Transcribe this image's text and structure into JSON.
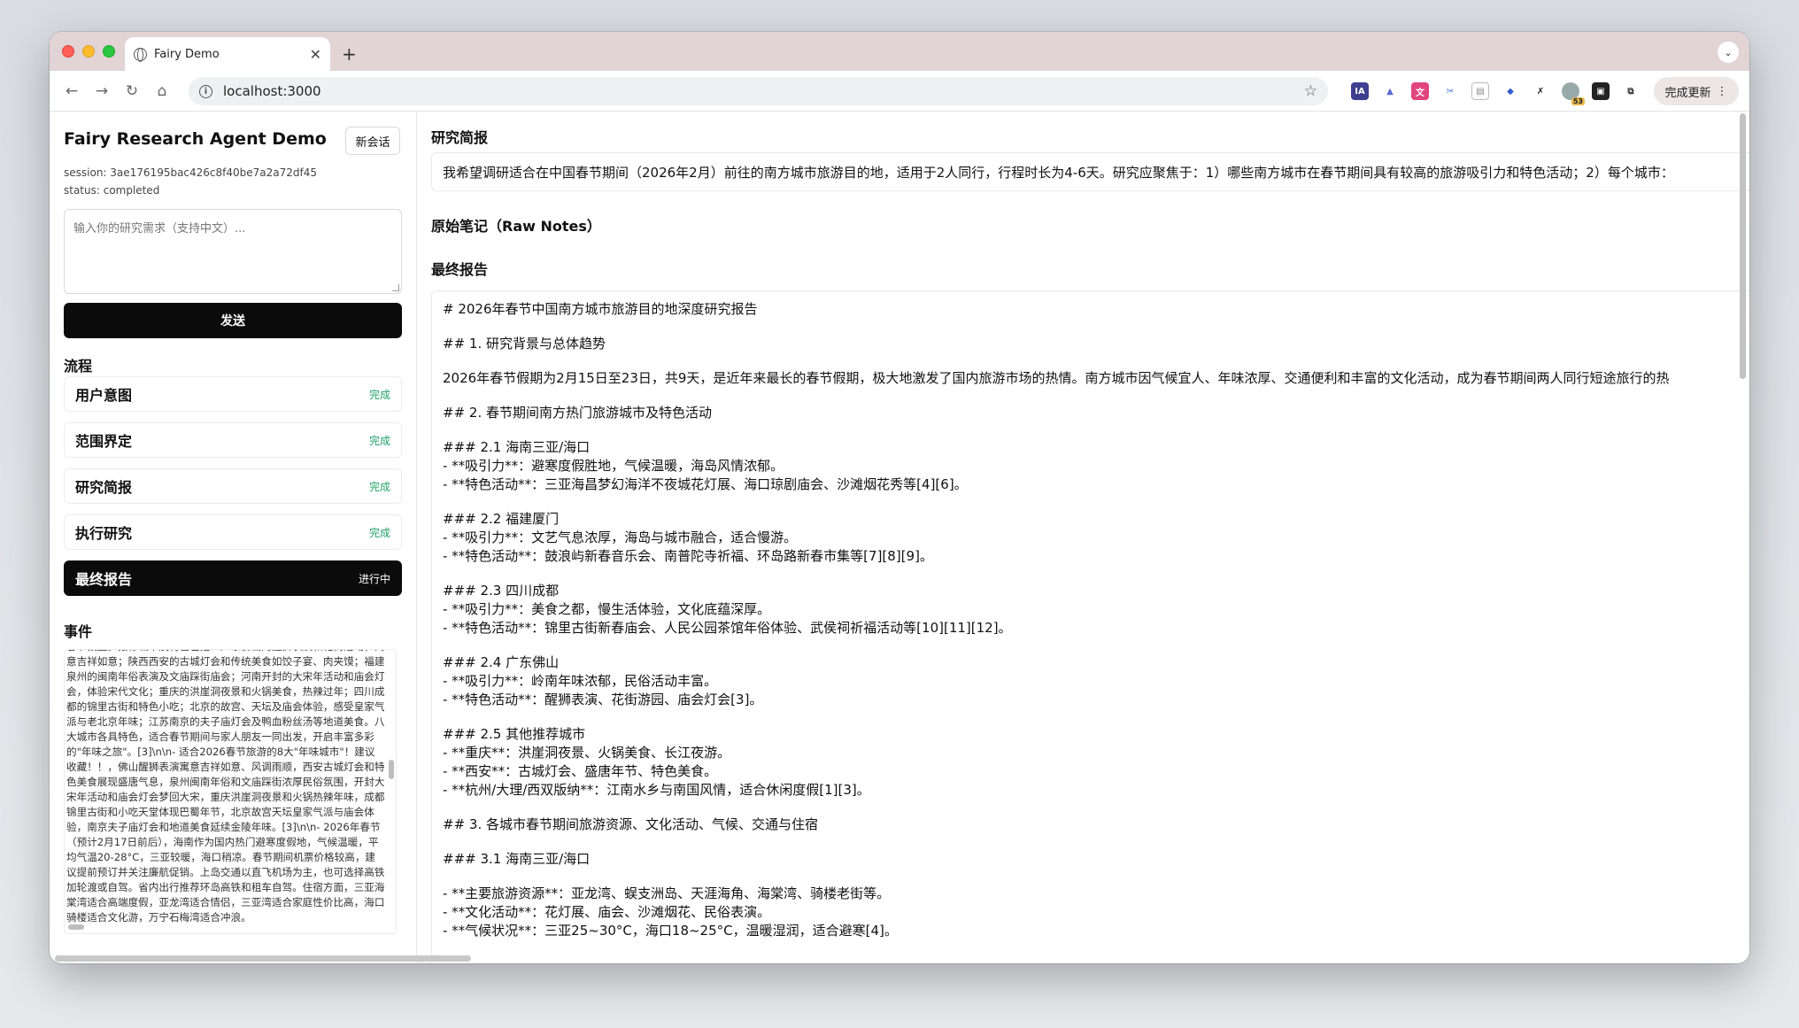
{
  "browser": {
    "tab_title": "Fairy Demo",
    "url": "localhost:3000",
    "update_label": "完成更新",
    "ext_badge": "53"
  },
  "sidebar": {
    "app_title": "Fairy Research Agent Demo",
    "new_session_label": "新会话",
    "session": "session: 3ae176195bac426c8f40be7a2a72df45",
    "status": "status: completed",
    "query_placeholder": "输入你的研究需求（支持中文）...",
    "send_label": "发送",
    "flow_label": "流程",
    "steps": [
      {
        "name": "用户意图",
        "status": "完成"
      },
      {
        "name": "范围界定",
        "status": "完成"
      },
      {
        "name": "研究简报",
        "status": "完成"
      },
      {
        "name": "执行研究",
        "status": "完成"
      },
      {
        "name": "最终报告",
        "status": "进行中"
      }
    ],
    "events_label": "事件",
    "events_text": "春节氛围。推荐城市及特色包括：广东佛山的醒狮表演和花街活动，寓意吉祥如意；陕西西安的古城灯会和传统美食如饺子宴、肉夹馍；福建泉州的闽南年俗表演及文庙踩街庙会；河南开封的大宋年活动和庙会灯会，体验宋代文化；重庆的洪崖洞夜景和火锅美食，热辣过年；四川成都的锦里古街和特色小吃；北京的故宫、天坛及庙会体验，感受皇家气派与老北京年味；江苏南京的夫子庙灯会及鸭血粉丝汤等地道美食。八大城市各具特色，适合春节期间与家人朋友一同出发，开启丰富多彩的\"年味之旅\"。[3]\\n\\n- 适合2026春节旅游的8大\"年味城市\"！建议收藏！！，佛山醒狮表演寓意吉祥如意、风调雨顺，西安古城灯会和特色美食展现盛唐气息，泉州闽南年俗和文庙踩街浓厚民俗氛围，开封大宋年活动和庙会灯会梦回大宋，重庆洪崖洞夜景和火锅热辣年味，成都锦里古街和小吃天堂体现巴蜀年节，北京故宫天坛皇家气派与庙会体验，南京夫子庙灯会和地道美食延续金陵年味。[3]\\n\\n- 2026年春节（预计2月17日前后），海南作为国内热门避寒度假地，气候温暖，平均气温20-28°C，三亚较暖，海口稍凉。春节期间机票价格较高，建议提前预订并关注廉航促销。上岛交通以直飞机场为主，也可选择高铁加轮渡或自驾。省内出行推荐环岛高铁和租车自驾。住宿方面，三亚海棠湾适合高端度假，亚龙湾适合情侣，三亚湾适合家庭性价比高，海口骑楼适合文化游，万宁石梅湾适合冲浪。",
    "events_text_display": ""
  },
  "main": {
    "brief_label": "研究简报",
    "brief_text": "我希望调研适合在中国春节期间（2026年2月）前往的南方城市旅游目的地，适用于2人同行，行程时长为4-6天。研究应聚焦于：1）哪些南方城市在春节期间具有较高的旅游吸引力和特色活动；2）每个城市：",
    "raw_notes_label": "原始笔记（Raw Notes）",
    "final_label": "最终报告",
    "report_lines": [
      "# 2026年春节中国南方城市旅游目的地深度研究报告",
      "",
      "## 1. 研究背景与总体趋势",
      "",
      "2026年春节假期为2月15日至23日，共9天，是近年来最长的春节假期，极大地激发了国内旅游市场的热情。南方城市因气候宜人、年味浓厚、交通便利和丰富的文化活动，成为春节期间两人同行短途旅行的热",
      "",
      "## 2. 春节期间南方热门旅游城市及特色活动",
      "",
      "### 2.1 海南三亚/海口",
      "- **吸引力**：避寒度假胜地，气候温暖，海岛风情浓郁。",
      "- **特色活动**：三亚海昌梦幻海洋不夜城花灯展、海口琼剧庙会、沙滩烟花秀等[4][6]。",
      "",
      "### 2.2 福建厦门",
      "- **吸引力**：文艺气息浓厚，海岛与城市融合，适合慢游。",
      "- **特色活动**：鼓浪屿新春音乐会、南普陀寺祈福、环岛路新春市集等[7][8][9]。",
      "",
      "### 2.3 四川成都",
      "- **吸引力**：美食之都，慢生活体验，文化底蕴深厚。",
      "- **特色活动**：锦里古街新春庙会、人民公园茶馆年俗体验、武侯祠祈福活动等[10][11][12]。",
      "",
      "### 2.4 广东佛山",
      "- **吸引力**：岭南年味浓郁，民俗活动丰富。",
      "- **特色活动**：醒狮表演、花街游园、庙会灯会[3]。",
      "",
      "### 2.5 其他推荐城市",
      "- **重庆**：洪崖洞夜景、火锅美食、长江夜游。",
      "- **西安**：古城灯会、盛唐年节、特色美食。",
      "- **杭州/大理/西双版纳**：江南水乡与南国风情，适合休闲度假[1][3]。",
      "",
      "## 3. 各城市春节期间旅游资源、文化活动、气候、交通与住宿",
      "",
      "### 3.1 海南三亚/海口",
      "",
      "- **主要旅游资源**：亚龙湾、蜈支洲岛、天涯海角、海棠湾、骑楼老街等。",
      "- **文化活动**：花灯展、庙会、沙滩烟花、民俗表演。",
      "- **气候状况**：三亚25~30°C，海口18~25°C，温暖湿润，适合避寒[4]。"
    ]
  }
}
